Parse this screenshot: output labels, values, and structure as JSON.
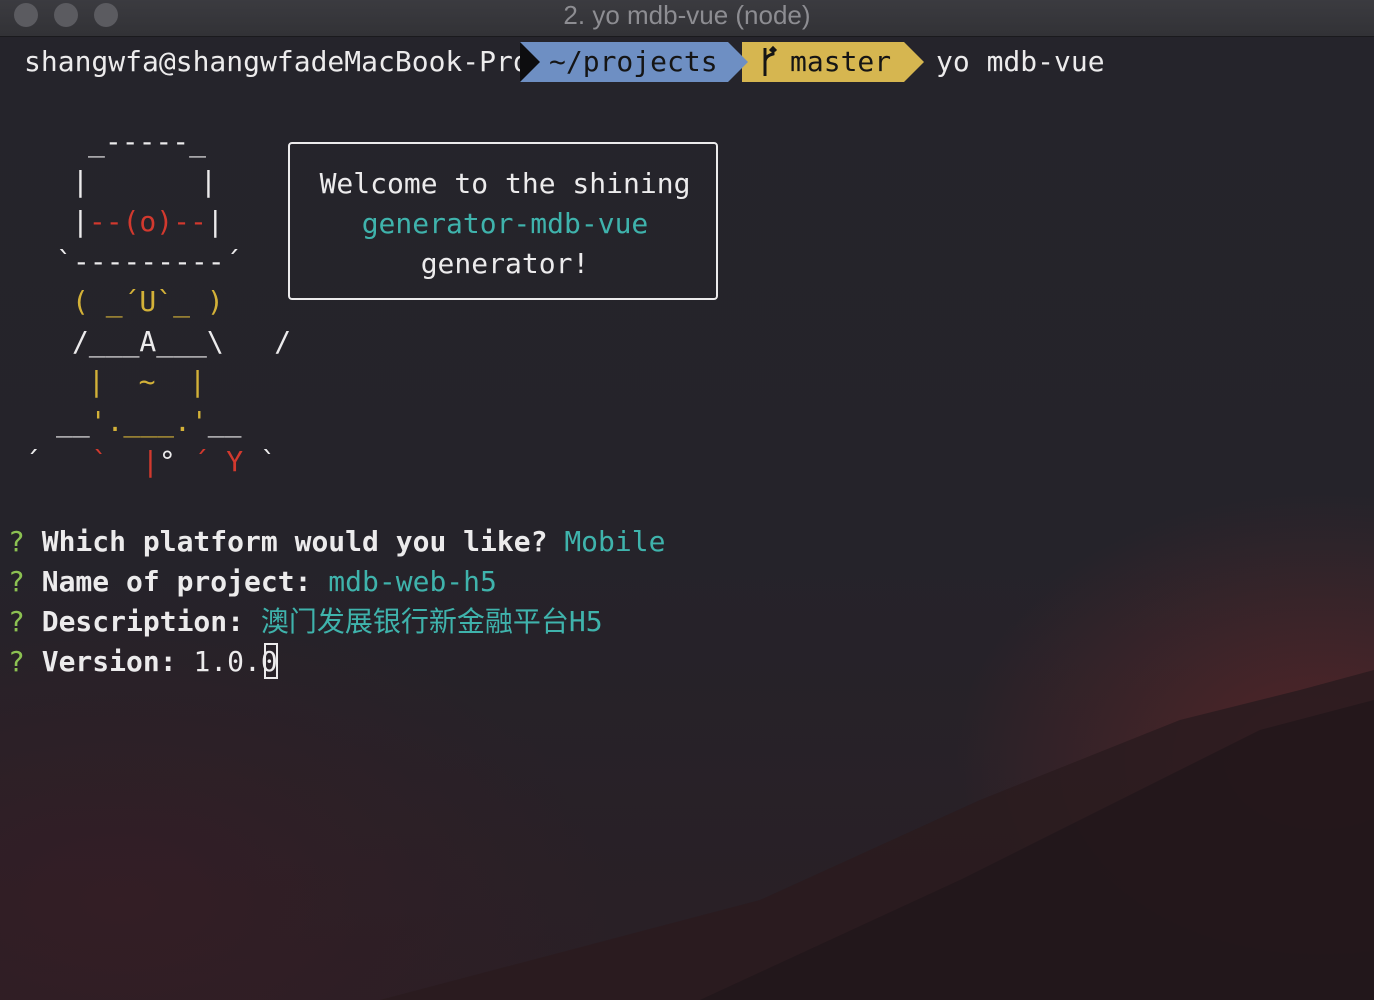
{
  "window": {
    "title": "2. yo mdb-vue (node)",
    "traffic_lights": [
      "close",
      "minimize",
      "zoom"
    ]
  },
  "prompt": {
    "user_host": "shangwfa@shangwfadeMacBook-Pro",
    "path": "~/projects",
    "branch": "master",
    "command": "yo mdb-vue",
    "colors": {
      "path_bg": "#6e8fc3",
      "branch_bg": "#d6b650"
    }
  },
  "ascii_art": {
    "line1": "_-----_",
    "line2a": "|",
    "line2b": "|",
    "line3a": "|",
    "line3b": "--(o)--",
    "line3c": "|",
    "line4": "`---------´",
    "line5": "( _´U`_ )",
    "line6": "/___A___\\   /",
    "line7": "|  ~  |",
    "line8a": "__",
    "line8b": "'.___.'",
    "line8c": "__",
    "line9a": "´   ",
    "line9b": "`  |",
    "line9c": "° ",
    "line9d": "´ Y ",
    "line9e": "`"
  },
  "welcome": {
    "line1": "Welcome to the shining",
    "line2": "generator-mdb-vue",
    "line3": "generator!"
  },
  "questions": [
    {
      "mark": "?",
      "label": "Which platform would you like?",
      "answer": "Mobile"
    },
    {
      "mark": "?",
      "label": "Name of project:",
      "answer": "mdb-web-h5"
    },
    {
      "mark": "?",
      "label": "Description:",
      "answer": "澳门发展银行新金融平台H5"
    },
    {
      "mark": "?",
      "label": "Version:",
      "answer": "1.0.0"
    }
  ]
}
